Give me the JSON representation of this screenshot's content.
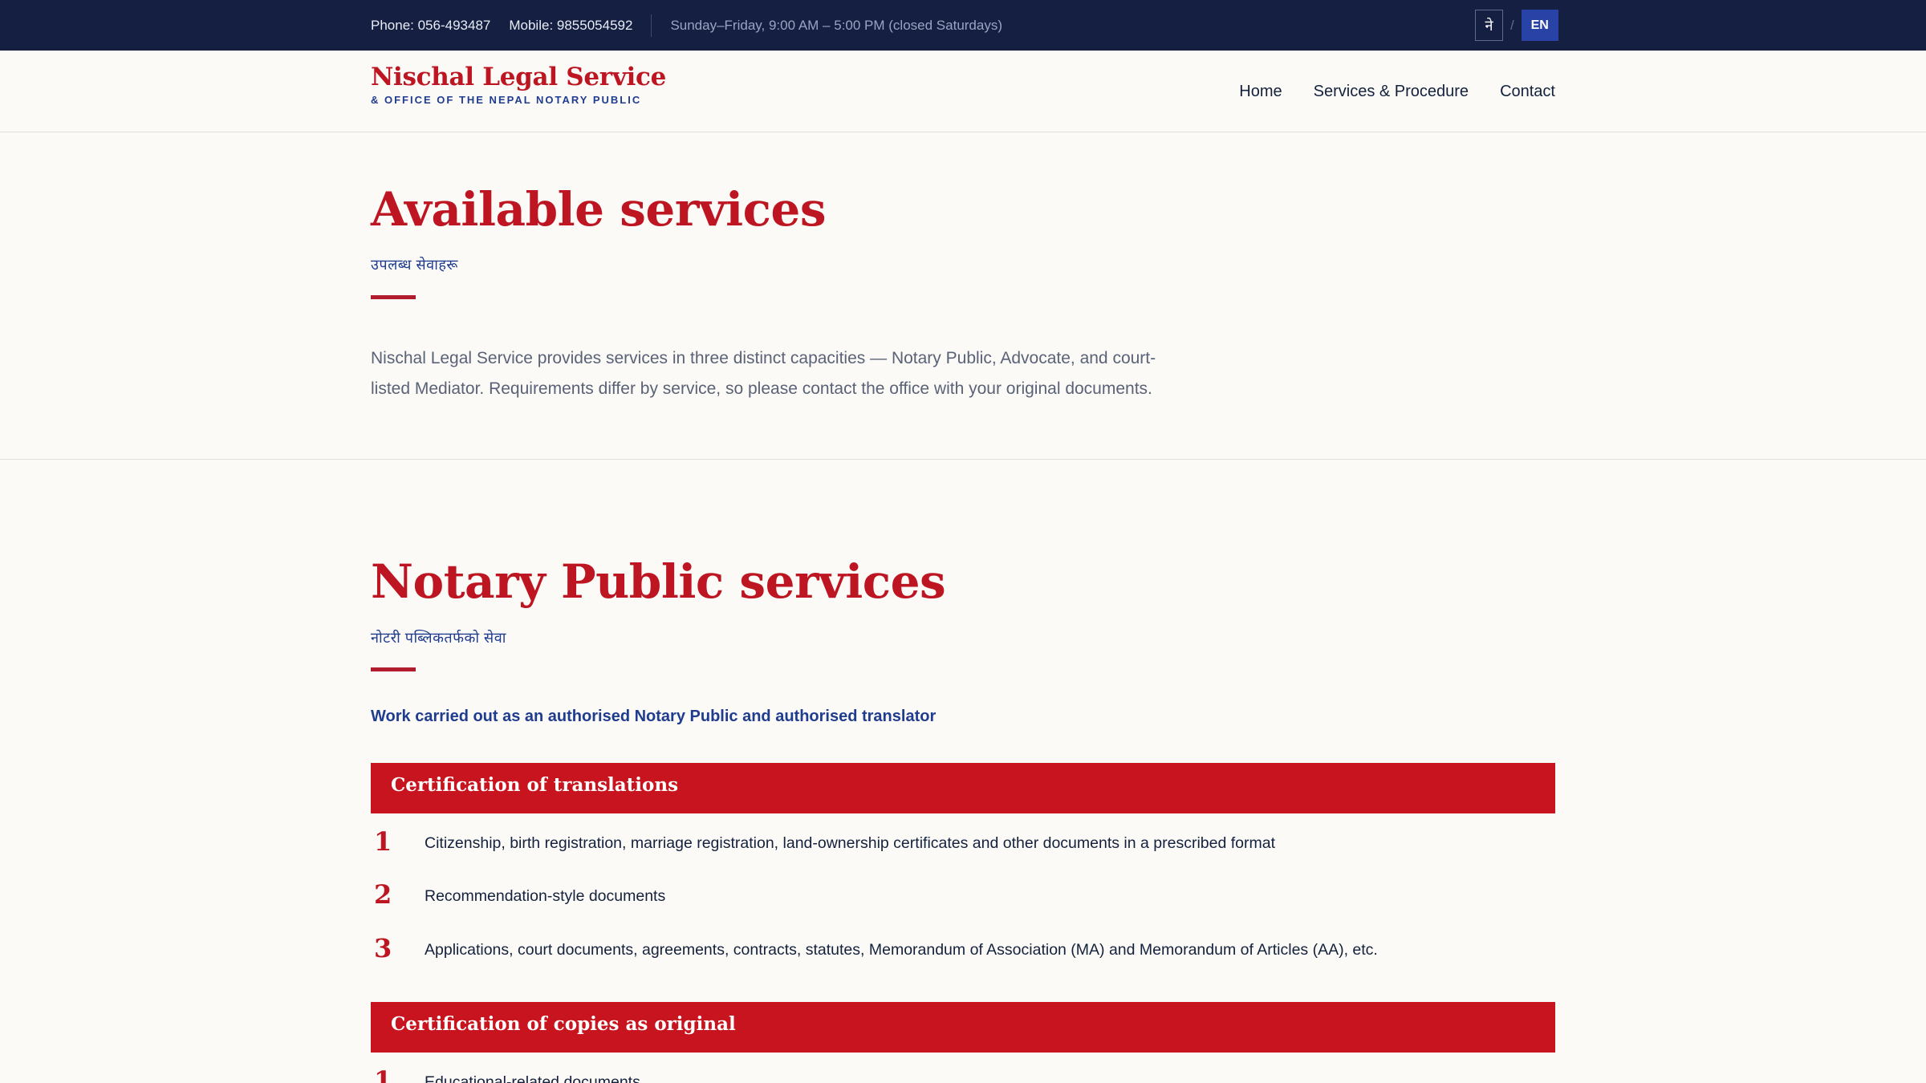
{
  "topbar": {
    "phone": "Phone: 056-493487",
    "mobile": "Mobile: 9855054592",
    "hours": "Sunday–Friday, 9:00 AM – 5:00 PM (closed Saturdays)",
    "lang_ne": "ने",
    "lang_sep": "/",
    "lang_en": "EN"
  },
  "header": {
    "brand_name": "Nischal Legal Service",
    "brand_sub": "& OFFICE OF THE NEPAL NOTARY PUBLIC",
    "nav": [
      "Home",
      "Services & Procedure",
      "Contact"
    ]
  },
  "intro": {
    "title": "Available services",
    "subtitle_np": "उपलब्ध सेवाहरू",
    "text": "Nischal Legal Service provides services in three distinct capacities — Notary Public, Advocate, and court-listed Mediator. Requirements differ by service, so please contact the office with your original documents."
  },
  "notary": {
    "title": "Notary Public services",
    "subtitle_np": "नोटरी पब्लिकतर्फको सेवा",
    "lead": "Work carried out as an authorised Notary Public and authorised translator",
    "groups": [
      {
        "title": "Certification of translations",
        "items": [
          {
            "num": "1",
            "text": "Citizenship, birth registration, marriage registration, land-ownership certificates and other documents in a prescribed format"
          },
          {
            "num": "2",
            "text": "Recommendation-style documents"
          },
          {
            "num": "3",
            "text": "Applications, court documents, agreements, contracts, statutes, Memorandum of Association (MA) and Memorandum of Articles (AA), etc."
          }
        ]
      },
      {
        "title": "Certification of copies as original",
        "items": [
          {
            "num": "1",
            "text": "Educational-related documents"
          }
        ]
      }
    ]
  },
  "colors": {
    "topbar_bg": "#141f42",
    "brand_red": "#bd1622",
    "band_red": "#c8141e",
    "accent_blue": "#1f3c8f",
    "page_bg": "#fbfaf6"
  }
}
